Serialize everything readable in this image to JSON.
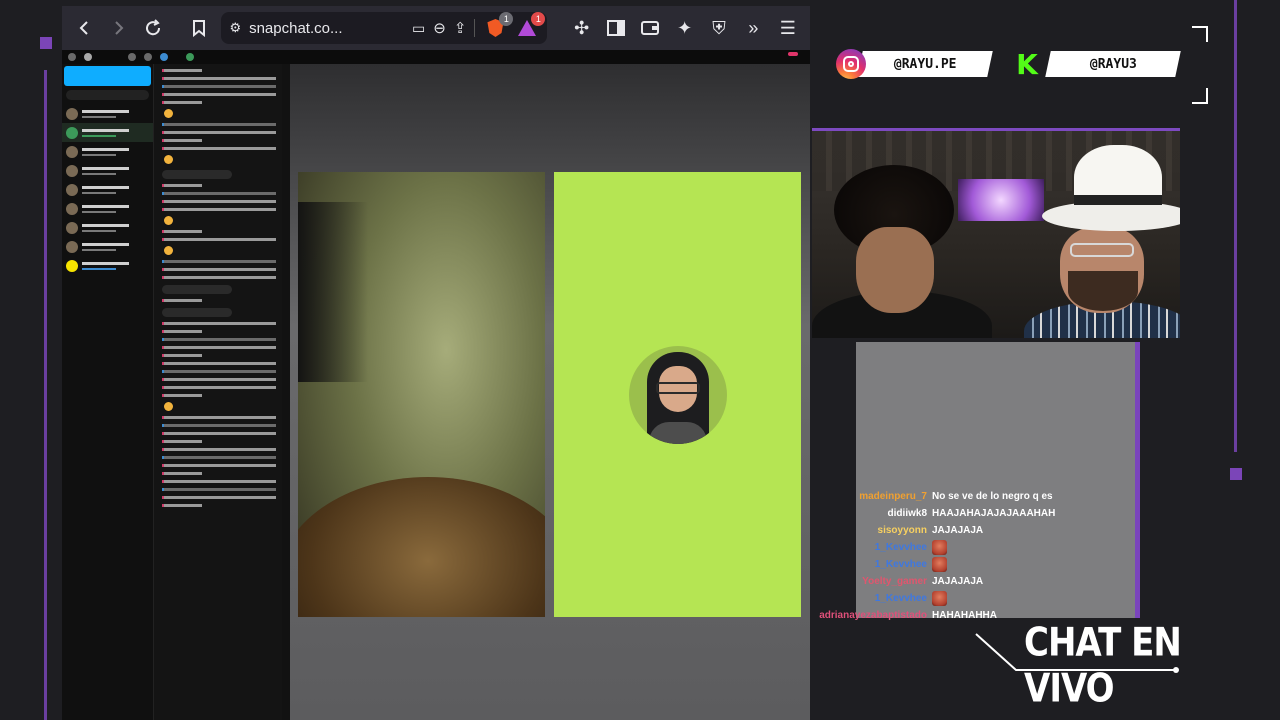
{
  "browser": {
    "url": "snapchat.co...",
    "brave_badge": "1",
    "ext_badge": "1"
  },
  "socials": {
    "instagram": "@RAYU.PE",
    "kick": "@RAYU3",
    "kick_logo": "K"
  },
  "chat": {
    "messages": [
      {
        "user": "madeinperu_7",
        "text": "No se ve de lo negro q es",
        "color": "#f0a030"
      },
      {
        "user": "didiiwk8",
        "text": "HAAJAHAJAJAJAAAHAH",
        "color": "#ffffff"
      },
      {
        "user": "sisoyyonn",
        "text": "JAJAJAJA",
        "color": "#f7d060"
      },
      {
        "user": "1_Kevvhee",
        "text": "",
        "color": "#3f78e0",
        "emote": true
      },
      {
        "user": "1_Kevvhee",
        "text": "",
        "color": "#3f78e0",
        "emote": true
      },
      {
        "user": "Yoelty_gamer",
        "text": "JAJAJAJA",
        "color": "#e0566e"
      },
      {
        "user": "1_Kevvhee",
        "text": "",
        "color": "#3f78e0",
        "emote": true
      },
      {
        "user": "adrianayezabaptistado",
        "text": "HAHAHAHHA",
        "color": "#e0507a"
      }
    ]
  },
  "overlay": {
    "chat_label": "CHAT EN VIVO"
  },
  "colors": {
    "accent_purple": "#7a44bc",
    "snap_green": "#b5e553",
    "kick_green": "#53fc18"
  }
}
